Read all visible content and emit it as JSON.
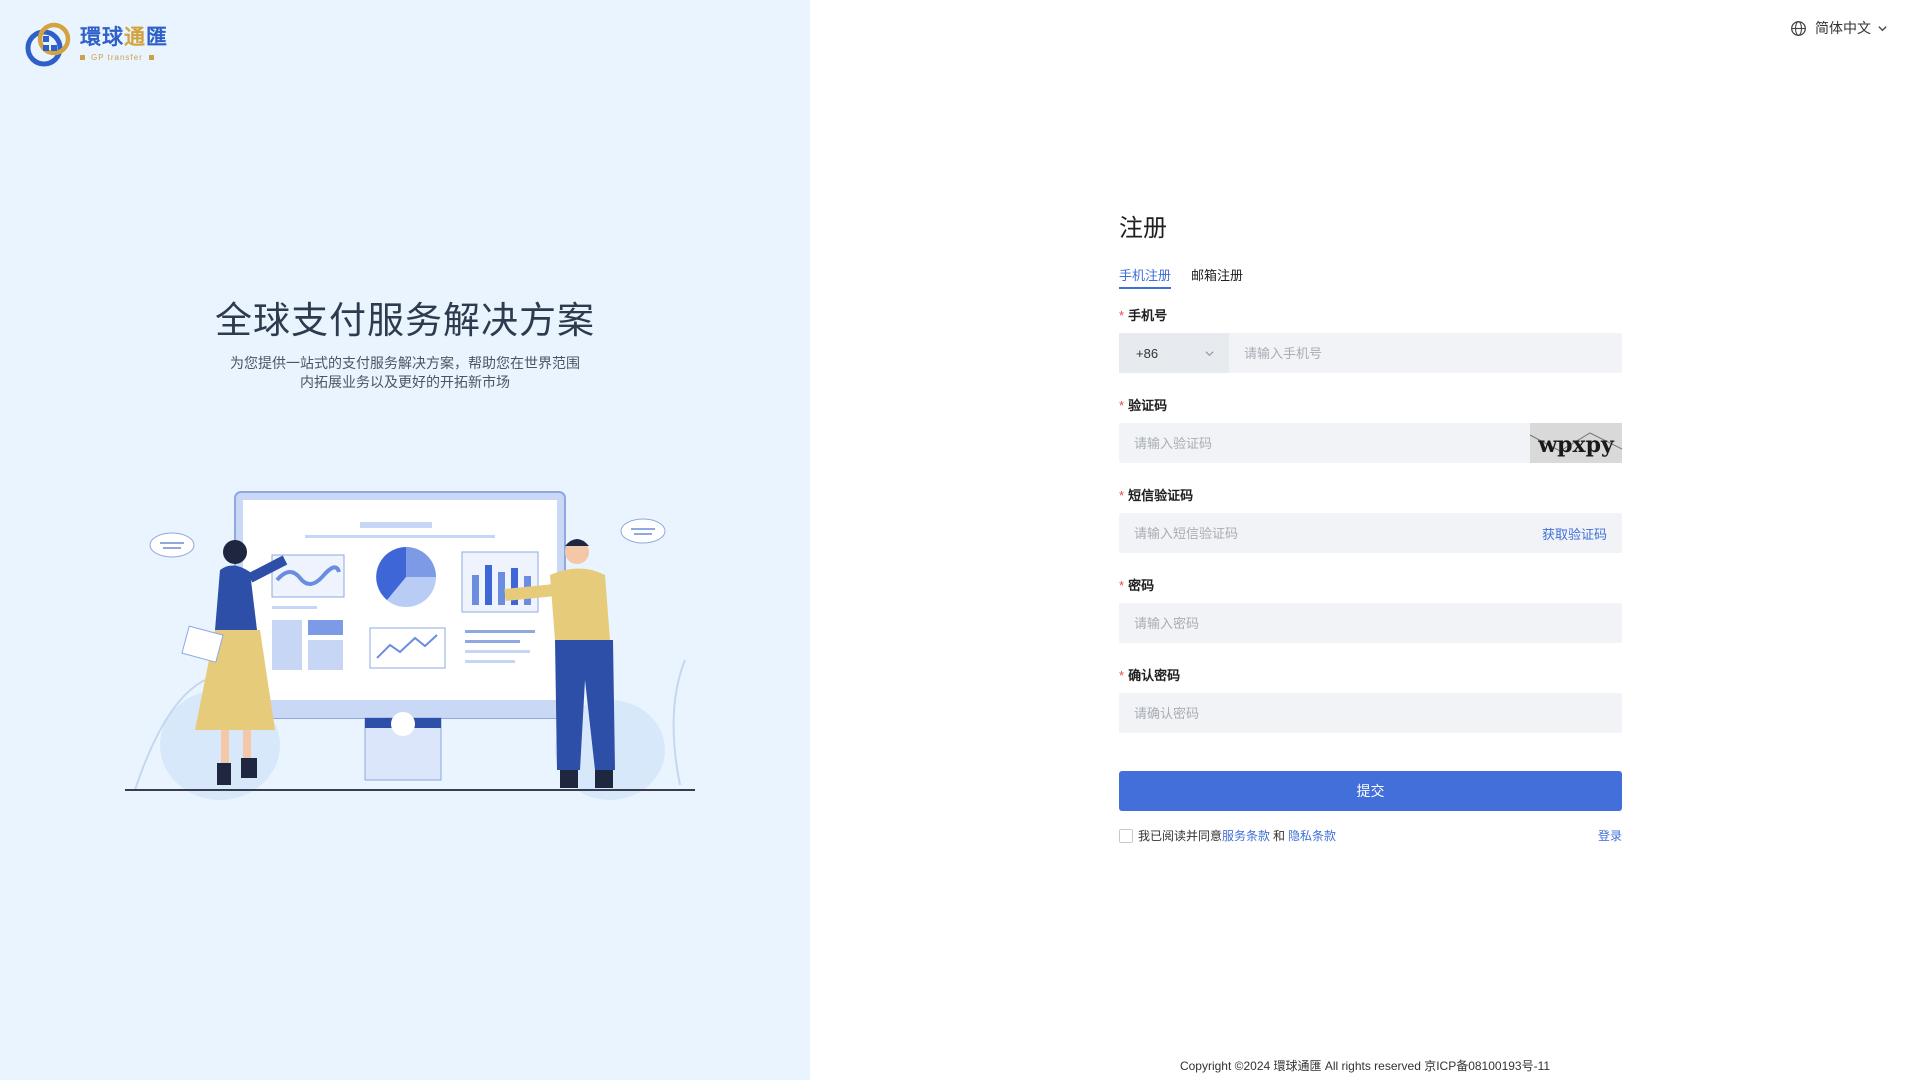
{
  "brand": {
    "name_part1": "環球",
    "name_part2": "通",
    "name_part3": "匯",
    "subtitle": "GP transfer"
  },
  "hero": {
    "title": "全球支付服务解决方案",
    "desc_line1": "为您提供一站式的支付服务解决方案，帮助您在世界范围",
    "desc_line2": "内拓展业务以及更好的开拓新市场"
  },
  "lang": {
    "label": "简体中文",
    "icon": "globe-icon"
  },
  "form": {
    "title": "注册",
    "tabs": [
      {
        "label": "手机注册",
        "active": true
      },
      {
        "label": "邮箱注册",
        "active": false
      }
    ],
    "phone": {
      "label": "手机号",
      "country_code": "+86",
      "placeholder": "请输入手机号"
    },
    "captcha": {
      "label": "验证码",
      "placeholder": "请输入验证码",
      "image_text": "wpxpy"
    },
    "sms": {
      "label": "短信验证码",
      "placeholder": "请输入短信验证码",
      "button": "获取验证码"
    },
    "password": {
      "label": "密码",
      "placeholder": "请输入密码"
    },
    "confirm": {
      "label": "确认密码",
      "placeholder": "请确认密码"
    },
    "submit": "提交",
    "agree": {
      "prefix": "我已阅读并同意",
      "terms": "服务条款",
      "and": "和",
      "privacy": "隐私条款",
      "checked": false
    },
    "login_link": "登录"
  },
  "footer": {
    "copyright": "Copyright ©2024 環球通匯 All rights reserved 京ICP备08100193号-11"
  },
  "colors": {
    "primary": "#426fd9",
    "link": "#3f6fd8",
    "left_bg": "#eaf4fe",
    "required": "#e5484d",
    "brand_gold": "#d2a340"
  }
}
